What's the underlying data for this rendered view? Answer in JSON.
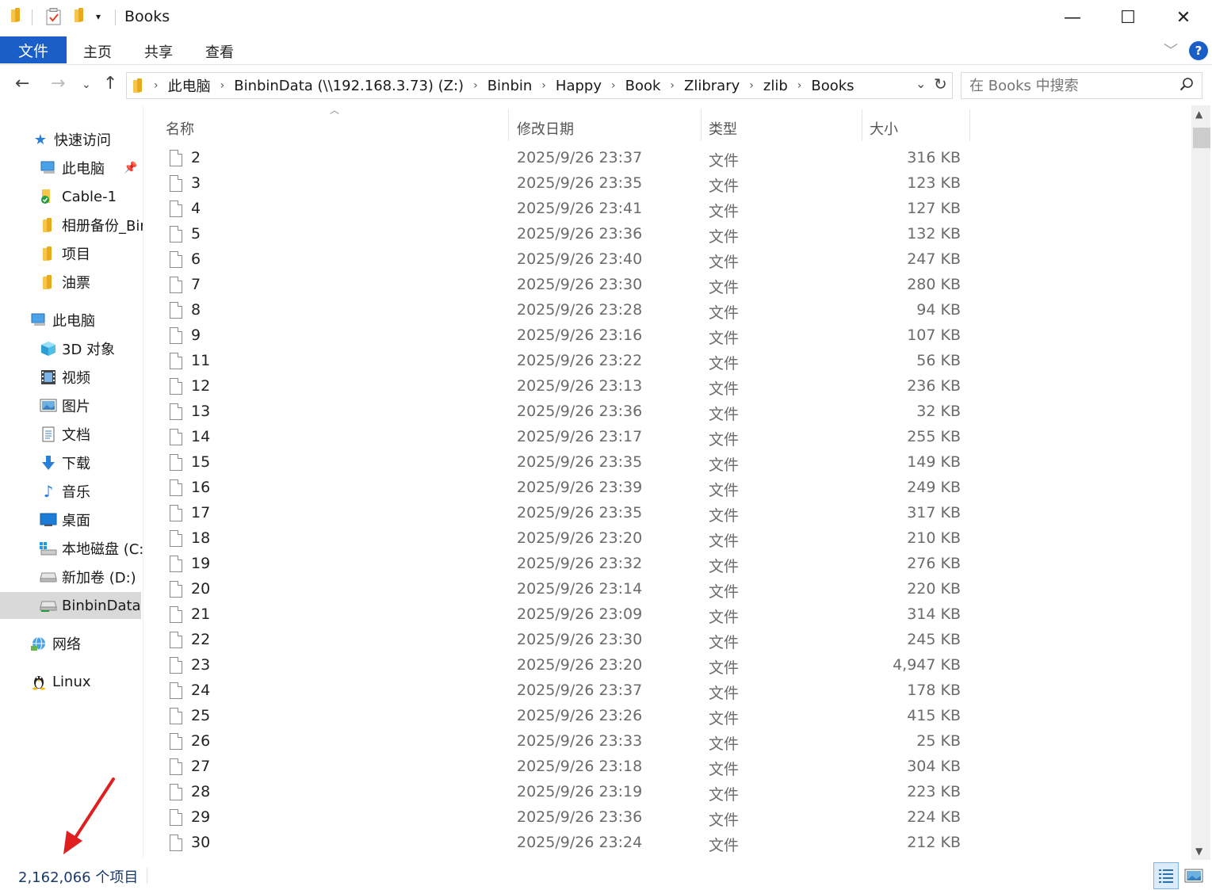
{
  "window": {
    "title": "Books",
    "minimize_glyph": "—",
    "maximize_glyph": "☐",
    "close_glyph": "✕"
  },
  "ribbon": {
    "tabs": [
      "文件",
      "主页",
      "共享",
      "查看"
    ],
    "help_glyph": "?"
  },
  "address": {
    "breadcrumbs": [
      "此电脑",
      "BinbinData (\\\\192.168.3.73) (Z:)",
      "Binbin",
      "Happy",
      "Book",
      "Zlibrary",
      "zlib",
      "Books"
    ]
  },
  "search": {
    "placeholder": "在 Books 中搜索"
  },
  "sidebar": {
    "items": [
      {
        "label": "快速访问",
        "icon": "star-icon",
        "indent": 0
      },
      {
        "label": "此电脑",
        "icon": "computer-icon",
        "indent": 1,
        "pinned": true
      },
      {
        "label": "Cable-1",
        "icon": "folder-sync-icon",
        "indent": 1
      },
      {
        "label": "相册备份_Bir",
        "icon": "folder-icon",
        "indent": 1
      },
      {
        "label": "项目",
        "icon": "folder-icon",
        "indent": 1
      },
      {
        "label": "油票",
        "icon": "folder-icon",
        "indent": 1
      },
      {
        "label": "此电脑",
        "icon": "computer-icon",
        "indent": 0
      },
      {
        "label": "3D 对象",
        "icon": "cube-icon",
        "indent": 1
      },
      {
        "label": "视频",
        "icon": "video-icon",
        "indent": 1
      },
      {
        "label": "图片",
        "icon": "picture-icon",
        "indent": 1
      },
      {
        "label": "文档",
        "icon": "document-icon",
        "indent": 1
      },
      {
        "label": "下载",
        "icon": "download-icon",
        "indent": 1
      },
      {
        "label": "音乐",
        "icon": "music-icon",
        "indent": 1
      },
      {
        "label": "桌面",
        "icon": "desktop-icon",
        "indent": 1
      },
      {
        "label": "本地磁盘 (C:",
        "icon": "system-drive-icon",
        "indent": 1
      },
      {
        "label": "新加卷 (D:)",
        "icon": "drive-icon",
        "indent": 1
      },
      {
        "label": "BinbinData",
        "icon": "network-drive-icon",
        "indent": 1,
        "selected": true
      },
      {
        "label": "网络",
        "icon": "network-icon",
        "indent": 0
      },
      {
        "label": "Linux",
        "icon": "linux-icon",
        "indent": 0
      }
    ]
  },
  "columns": {
    "name": "名称",
    "modified": "修改日期",
    "type": "类型",
    "size": "大小"
  },
  "files": [
    {
      "name": "2",
      "modified": "2025/9/26 23:37",
      "type": "文件",
      "size": "316 KB"
    },
    {
      "name": "3",
      "modified": "2025/9/26 23:35",
      "type": "文件",
      "size": "123 KB"
    },
    {
      "name": "4",
      "modified": "2025/9/26 23:41",
      "type": "文件",
      "size": "127 KB"
    },
    {
      "name": "5",
      "modified": "2025/9/26 23:36",
      "type": "文件",
      "size": "132 KB"
    },
    {
      "name": "6",
      "modified": "2025/9/26 23:40",
      "type": "文件",
      "size": "247 KB"
    },
    {
      "name": "7",
      "modified": "2025/9/26 23:30",
      "type": "文件",
      "size": "280 KB"
    },
    {
      "name": "8",
      "modified": "2025/9/26 23:28",
      "type": "文件",
      "size": "94 KB"
    },
    {
      "name": "9",
      "modified": "2025/9/26 23:16",
      "type": "文件",
      "size": "107 KB"
    },
    {
      "name": "11",
      "modified": "2025/9/26 23:22",
      "type": "文件",
      "size": "56 KB"
    },
    {
      "name": "12",
      "modified": "2025/9/26 23:13",
      "type": "文件",
      "size": "236 KB"
    },
    {
      "name": "13",
      "modified": "2025/9/26 23:36",
      "type": "文件",
      "size": "32 KB"
    },
    {
      "name": "14",
      "modified": "2025/9/26 23:17",
      "type": "文件",
      "size": "255 KB"
    },
    {
      "name": "15",
      "modified": "2025/9/26 23:35",
      "type": "文件",
      "size": "149 KB"
    },
    {
      "name": "16",
      "modified": "2025/9/26 23:39",
      "type": "文件",
      "size": "249 KB"
    },
    {
      "name": "17",
      "modified": "2025/9/26 23:35",
      "type": "文件",
      "size": "317 KB"
    },
    {
      "name": "18",
      "modified": "2025/9/26 23:20",
      "type": "文件",
      "size": "210 KB"
    },
    {
      "name": "19",
      "modified": "2025/9/26 23:32",
      "type": "文件",
      "size": "276 KB"
    },
    {
      "name": "20",
      "modified": "2025/9/26 23:14",
      "type": "文件",
      "size": "220 KB"
    },
    {
      "name": "21",
      "modified": "2025/9/26 23:09",
      "type": "文件",
      "size": "314 KB"
    },
    {
      "name": "22",
      "modified": "2025/9/26 23:30",
      "type": "文件",
      "size": "245 KB"
    },
    {
      "name": "23",
      "modified": "2025/9/26 23:20",
      "type": "文件",
      "size": "4,947 KB"
    },
    {
      "name": "24",
      "modified": "2025/9/26 23:37",
      "type": "文件",
      "size": "178 KB"
    },
    {
      "name": "25",
      "modified": "2025/9/26 23:26",
      "type": "文件",
      "size": "415 KB"
    },
    {
      "name": "26",
      "modified": "2025/9/26 23:33",
      "type": "文件",
      "size": "25 KB"
    },
    {
      "name": "27",
      "modified": "2025/9/26 23:18",
      "type": "文件",
      "size": "304 KB"
    },
    {
      "name": "28",
      "modified": "2025/9/26 23:19",
      "type": "文件",
      "size": "223 KB"
    },
    {
      "name": "29",
      "modified": "2025/9/26 23:36",
      "type": "文件",
      "size": "224 KB"
    },
    {
      "name": "30",
      "modified": "2025/9/26 23:24",
      "type": "文件",
      "size": "212 KB"
    }
  ],
  "status": {
    "item_count": "2,162,066 个项目"
  },
  "colors": {
    "accent": "#1a5ec7",
    "annotation_arrow": "#e02020",
    "selected_bg": "#d9d9d9"
  }
}
